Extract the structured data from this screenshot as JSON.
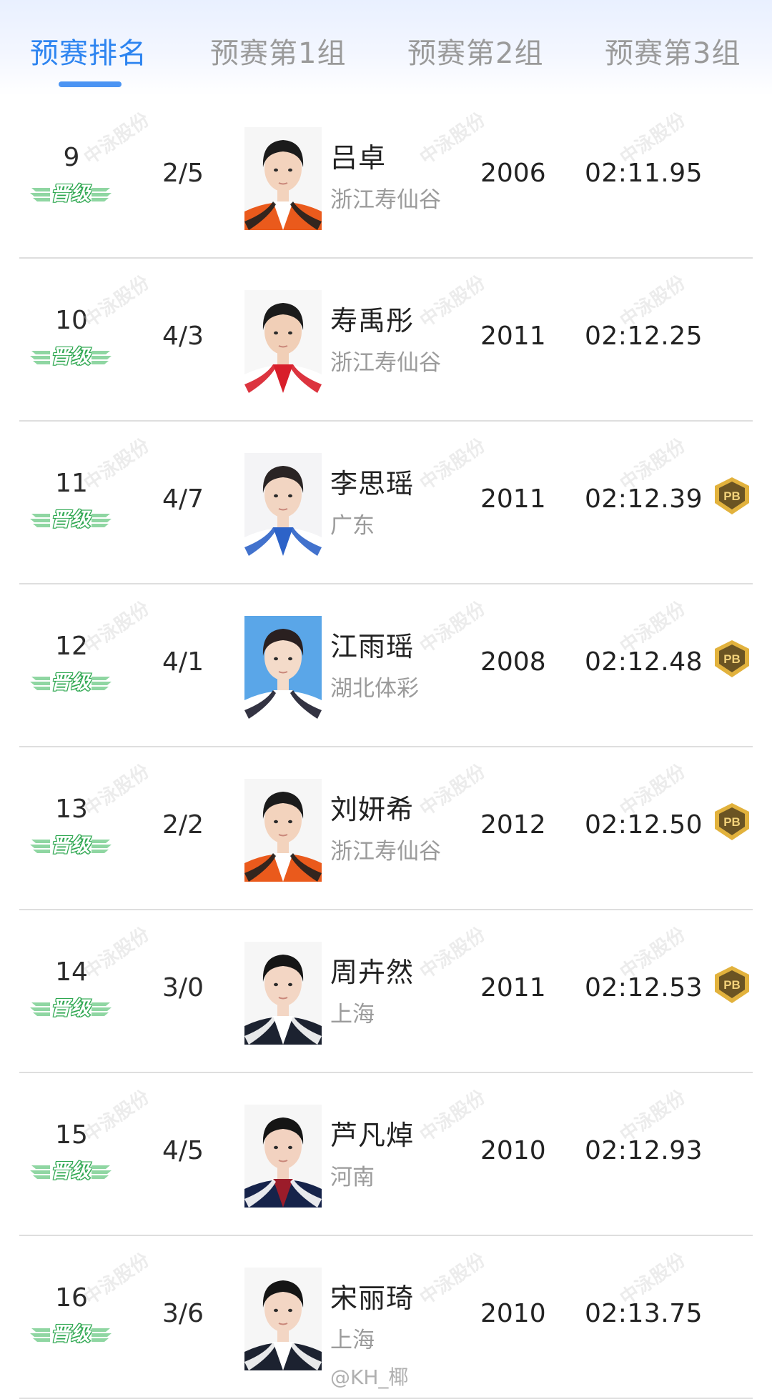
{
  "tabs": [
    {
      "label": "预赛排名",
      "active": true
    },
    {
      "label": "预赛第1组",
      "active": false
    },
    {
      "label": "预赛第2组",
      "active": false
    },
    {
      "label": "预赛第3组",
      "active": false
    }
  ],
  "badges": {
    "promoted_label": "晋级",
    "pb_label": "PB"
  },
  "watermark": "中泳股份",
  "colors": {
    "accent": "#2d84f0",
    "promote_green": "#3cb55f",
    "pb_gold": "#e2b23d"
  },
  "rows": [
    {
      "rank": "9",
      "lane": "2/5",
      "name": "吕卓",
      "team": "浙江寿仙谷",
      "year": "2006",
      "time": "02:11.95",
      "pb": false,
      "photo": "orange-jacket"
    },
    {
      "rank": "10",
      "lane": "4/3",
      "name": "寿禹彤",
      "team": "浙江寿仙谷",
      "year": "2011",
      "time": "02:12.25",
      "pb": false,
      "photo": "red-white-jacket"
    },
    {
      "rank": "11",
      "lane": "4/7",
      "name": "李思瑶",
      "team": "广东",
      "year": "2011",
      "time": "02:12.39",
      "pb": true,
      "photo": "school-uniform"
    },
    {
      "rank": "12",
      "lane": "4/1",
      "name": "江雨瑶",
      "team": "湖北体彩",
      "year": "2008",
      "time": "02:12.48",
      "pb": true,
      "photo": "blue-background"
    },
    {
      "rank": "13",
      "lane": "2/2",
      "name": "刘妍希",
      "team": "浙江寿仙谷",
      "year": "2012",
      "time": "02:12.50",
      "pb": true,
      "photo": "orange-jacket"
    },
    {
      "rank": "14",
      "lane": "3/0",
      "name": "周卉然",
      "team": "上海",
      "year": "2011",
      "time": "02:12.53",
      "pb": true,
      "photo": "dark-suit"
    },
    {
      "rank": "15",
      "lane": "4/5",
      "name": "芦凡焯",
      "team": "河南",
      "year": "2010",
      "time": "02:12.93",
      "pb": false,
      "photo": "navy-suit"
    },
    {
      "rank": "16",
      "lane": "3/6",
      "name": "宋丽琦",
      "team": "上海",
      "year": "2010",
      "time": "02:13.75",
      "pb": false,
      "photo": "dark-suit"
    }
  ],
  "credit": "@KH_椰"
}
